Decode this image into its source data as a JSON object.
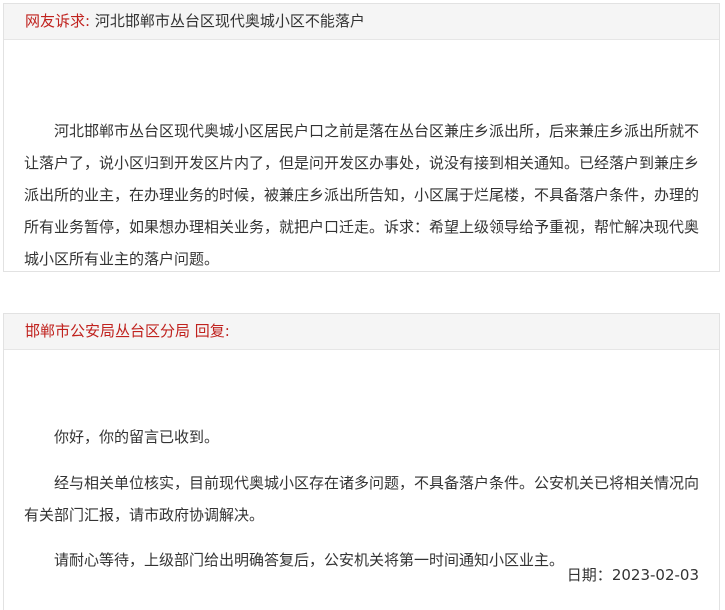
{
  "complaint": {
    "label": "网友诉求:",
    "title": "河北邯郸市丛台区现代奥城小区不能落户",
    "body": "河北邯郸市丛台区现代奥城小区居民户口之前是落在丛台区兼庄乡派出所，后来兼庄乡派出所就不让落户了，说小区归到开发区片内了，但是问开发区办事处，说没有接到相关通知。已经落户到兼庄乡派出所的业主，在办理业务的时候，被兼庄乡派出所告知，小区属于烂尾楼，不具备落户条件，办理的所有业务暂停，如果想办理相关业务，就把户口迁走。诉求：希望上级领导给予重视，帮忙解决现代奥城小区所有业主的落户问题。"
  },
  "reply": {
    "label": "邯郸市公安局丛台区分局 回复:",
    "paragraphs": [
      "你好，你的留言已收到。",
      "经与相关单位核实，目前现代奥城小区存在诸多问题，不具备落户条件。公安机关已将相关情况向有关部门汇报，请市政府协调解决。",
      "请耐心等待，上级部门给出明确答复后，公安机关将第一时间通知小区业主。"
    ],
    "date_label": "日期：",
    "date": "2023-02-03"
  },
  "colors": {
    "accent_red": "#c0221e",
    "header_bg": "#f5f5f5",
    "border": "#e2e2e2",
    "text": "#333333"
  }
}
